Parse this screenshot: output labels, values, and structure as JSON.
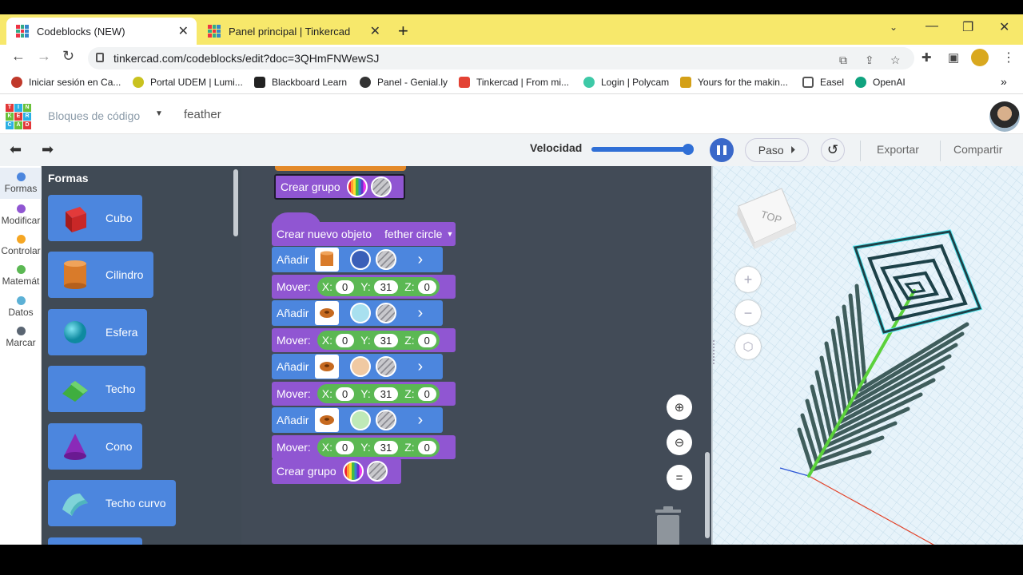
{
  "browser": {
    "tabs": [
      {
        "label": "Codeblocks (NEW)",
        "active": true
      },
      {
        "label": "Panel principal | Tinkercad",
        "active": false
      }
    ],
    "url": "tinkercad.com/codeblocks/edit?doc=3QHmFNWewSJ",
    "bookmarks": [
      {
        "label": "Iniciar sesión en Ca...",
        "color": "#c0392b"
      },
      {
        "label": "Portal UDEM | Lumi...",
        "color": "#c9c21f"
      },
      {
        "label": "Blackboard Learn",
        "color": "#222222"
      },
      {
        "label": "Panel - Genial.ly",
        "color": "#333333"
      },
      {
        "label": "Tinkercad | From mi...",
        "color": "#e34234"
      },
      {
        "label": "Login | Polycam",
        "color": "#3ec9a7"
      },
      {
        "label": "Yours for the makin...",
        "color": "#d4a017"
      },
      {
        "label": "Easel",
        "color": "#555555"
      },
      {
        "label": "OpenAI",
        "color": "#10a37f"
      }
    ]
  },
  "header": {
    "logo_letters": [
      "T",
      "I",
      "N",
      "K",
      "E",
      "R",
      "C",
      "A",
      "D"
    ],
    "mode": "Bloques de código",
    "doc_name": "feather"
  },
  "controls": {
    "speed_label": "Velocidad",
    "speed_value": 1.0,
    "step_label": "Paso",
    "export_label": "Exportar",
    "share_label": "Compartir"
  },
  "categories": [
    {
      "label": "Formas",
      "color": "#4c86de"
    },
    {
      "label": "Modificar",
      "color": "#9056d2"
    },
    {
      "label": "Controlar",
      "color": "#f5a623"
    },
    {
      "label": "Matemát",
      "color": "#5bb853"
    },
    {
      "label": "Datos",
      "color": "#5cb1d6"
    },
    {
      "label": "Marcar",
      "color": "#5a6572"
    }
  ],
  "palette": {
    "title": "Formas",
    "items": [
      {
        "label": "Cubo",
        "icon": "cube-icon"
      },
      {
        "label": "Cilindro",
        "icon": "cylinder-icon"
      },
      {
        "label": "Esfera",
        "icon": "sphere-icon"
      },
      {
        "label": "Techo",
        "icon": "roof-icon"
      },
      {
        "label": "Cono",
        "icon": "cone-icon"
      },
      {
        "label": "Techo curvo",
        "icon": "curved-roof-icon"
      }
    ]
  },
  "script": {
    "top_group_label": "Crear grupo",
    "create_label": "Crear nuevo objeto",
    "object_name": "fether circle",
    "add_label": "Añadir",
    "move_label": "Mover:",
    "x_label": "X:",
    "y_label": "Y:",
    "z_label": "Z:",
    "add_blocks": [
      {
        "color": "#3a5fb8"
      },
      {
        "color": "#a8e0ef"
      },
      {
        "color": "#f0c9a2"
      },
      {
        "color": "#bfe9b7"
      }
    ],
    "move_blocks": [
      {
        "x": "0",
        "y": "31",
        "z": "0"
      },
      {
        "x": "0",
        "y": "31",
        "z": "0"
      },
      {
        "x": "0",
        "y": "31",
        "z": "0"
      },
      {
        "x": "0",
        "y": "31",
        "z": "0"
      }
    ],
    "group_label": "Crear grupo"
  },
  "viewport": {
    "view_cube_label": "TOP"
  }
}
